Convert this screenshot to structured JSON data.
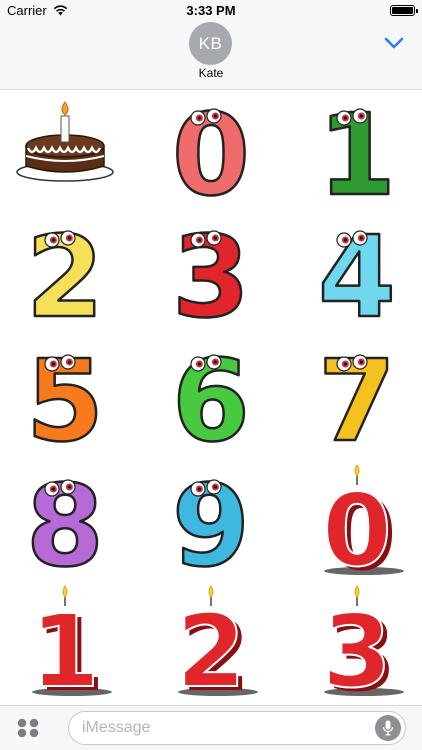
{
  "status_bar": {
    "carrier": "Carrier",
    "time": "3:33 PM",
    "wifi_icon": "wifi-icon",
    "battery_icon": "battery-icon"
  },
  "header": {
    "avatar_initials": "KB",
    "contact_name": "Kate",
    "collapse_icon": "chevron-down-icon",
    "accent_color": "#2d7cf6"
  },
  "stickers": [
    {
      "kind": "birthday-cake",
      "label": ""
    },
    {
      "kind": "cartoon-number",
      "label": "0",
      "color": "#f06b6b"
    },
    {
      "kind": "cartoon-number",
      "label": "1",
      "color": "#2f9a2f"
    },
    {
      "kind": "cartoon-number",
      "label": "2",
      "color": "#f6e05a"
    },
    {
      "kind": "cartoon-number",
      "label": "3",
      "color": "#e0262a"
    },
    {
      "kind": "cartoon-number",
      "label": "4",
      "color": "#6fd8ef"
    },
    {
      "kind": "cartoon-number",
      "label": "5",
      "color": "#f77a1c"
    },
    {
      "kind": "cartoon-number",
      "label": "6",
      "color": "#47c940"
    },
    {
      "kind": "cartoon-number",
      "label": "7",
      "color": "#f3c21e"
    },
    {
      "kind": "cartoon-number",
      "label": "8",
      "color": "#b56ad6"
    },
    {
      "kind": "cartoon-number",
      "label": "9",
      "color": "#3fb8df"
    },
    {
      "kind": "candle-number",
      "label": "0",
      "color": "#e0262a"
    },
    {
      "kind": "candle-number",
      "label": "1",
      "color": "#e0262a"
    },
    {
      "kind": "candle-number",
      "label": "2",
      "color": "#e0262a"
    },
    {
      "kind": "candle-number",
      "label": "3",
      "color": "#e0262a"
    }
  ],
  "input_bar": {
    "apps_icon": "app-drawer-icon",
    "placeholder": "iMessage",
    "value": "",
    "mic_icon": "microphone-icon"
  }
}
